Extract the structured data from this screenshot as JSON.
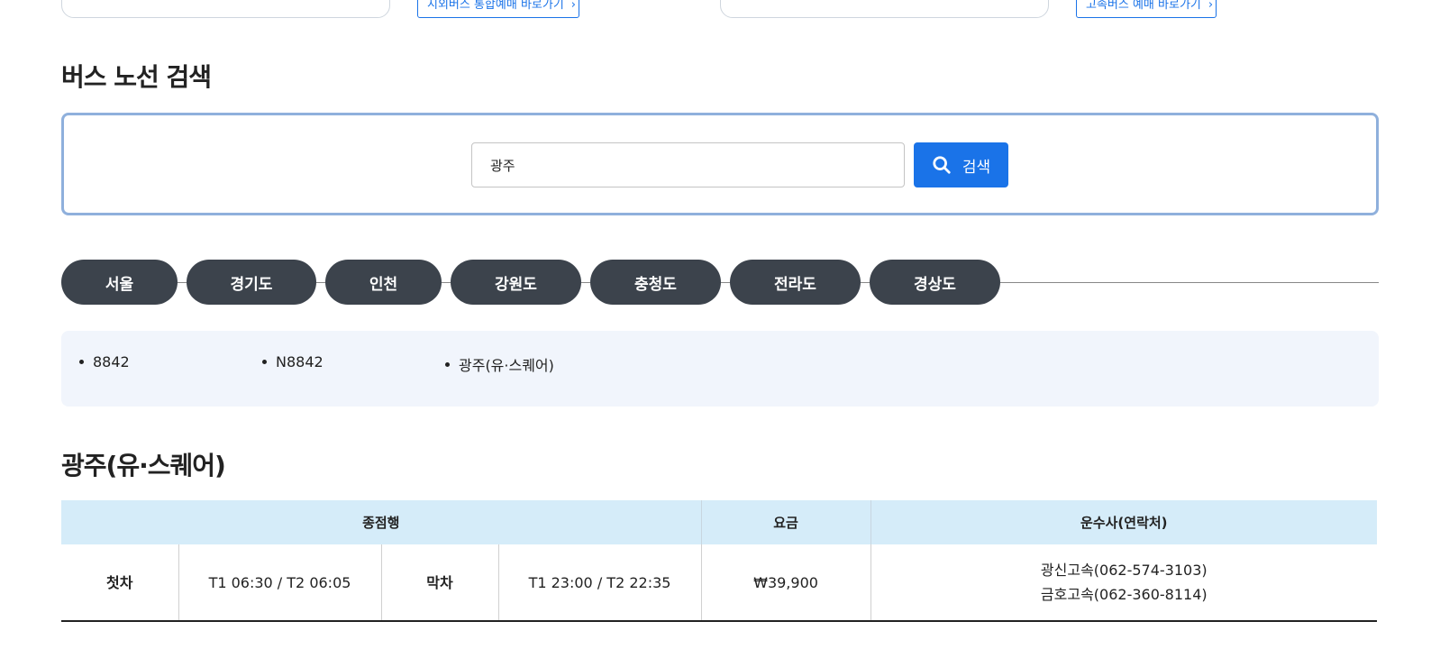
{
  "top_links": {
    "intercity": "시외버스 통합예매 바로가기",
    "express": "고속버스 예매 바로가기"
  },
  "search_section": {
    "title": "버스 노선 검색",
    "input_value": "광주",
    "button_label": "검색"
  },
  "regions": [
    "서울",
    "경기도",
    "인천",
    "강원도",
    "충청도",
    "전라도",
    "경상도"
  ],
  "routes": [
    "8842",
    "N8842",
    "광주(유·스퀘어)"
  ],
  "detail": {
    "title": "광주(유·스퀘어)",
    "headers": {
      "terminus": "종점행",
      "fare": "요금",
      "operator": "운수사(연락처)"
    },
    "first_label": "첫차",
    "first_time": "T1 06:30 / T2 06:05",
    "last_label": "막차",
    "last_time": "T1 23:00 / T2 22:35",
    "fare": "₩39,900",
    "operators": [
      "광신고속(062-574-3103)",
      "금호고속(062-360-8114)"
    ]
  },
  "colors": {
    "accent": "#1a73e8",
    "tab_bg": "#3c434c",
    "list_bg": "#f1f5fc",
    "table_header_bg": "#d5ecf9"
  },
  "icons": {
    "search": "search-icon",
    "chevron": "chevron-right-icon"
  }
}
